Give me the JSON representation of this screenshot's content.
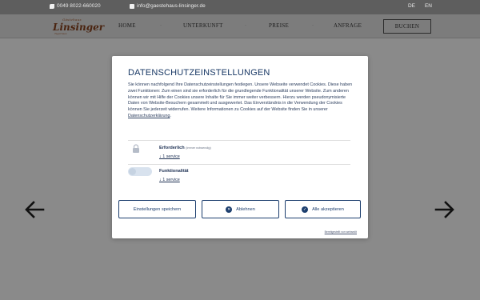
{
  "topbar": {
    "phone": "0049 8022-660020",
    "email": "info@gaestehaus-linsinger.de",
    "lang_de": "DE",
    "lang_en": "EN"
  },
  "logo": {
    "small": "Gästehaus",
    "big": "Linsinger",
    "tag": "Tegernsee"
  },
  "nav": {
    "home": "HOME",
    "unterkunft": "UNTERKUNFT",
    "preise": "PREISE",
    "anfrage": "ANFRAGE",
    "buchen": "BUCHEN",
    "separator": "·"
  },
  "modal": {
    "title": "DATENSCHUTZEINSTELLUNGEN",
    "body": "Sie können nachfolgend Ihre Datenschutzeinstellungen festlegen. Unsere Webseite verwendet Cookies. Diese haben zwei Funktionen: Zum einen sind sie erforderlich für die grundlegende Funktionalität unserer Website. Zum anderen können wir mit Hilfe der Cookies unsere Inhalte für Sie immer weiter verbessern. Hierzu werden pseudonymisierte Daten von Website-Besuchern gesammelt und ausgewertet. Das Einverständnis in die Verwendung der Cookies können Sie jederzeit widerrufen. Weitere Informationen zu Cookies auf der Website finden Sie in unserer ",
    "privacy_link": "Datenschutzerklärung",
    "body_end": ".",
    "purposes": [
      {
        "label": "Erforderlich",
        "note": "(immer notwendig)",
        "service": "↓ 1 service"
      },
      {
        "label": "Funktionalität",
        "service": "↓ 1 service",
        "enabled": false
      }
    ],
    "buttons": {
      "save": "Einstellungen speichern",
      "decline": "Ablehnen",
      "accept": "Alle akzeptieren"
    },
    "powered_by": "Bereitgestellt von websedit"
  },
  "colors": {
    "overlay": "#8a8a8a",
    "primary": "#1c3e6e",
    "title": "#173764"
  }
}
